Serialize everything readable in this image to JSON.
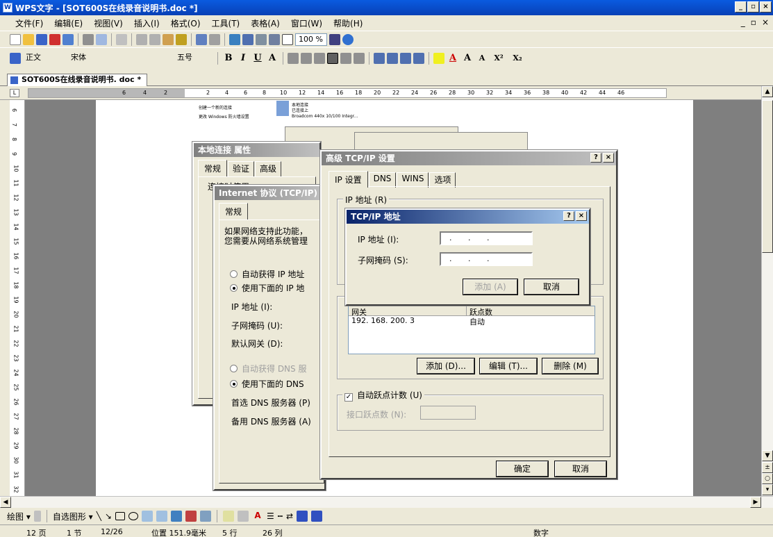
{
  "window": {
    "title": "WPS文字 - [SOT600S在线录音说明书.doc *]",
    "min": "_",
    "max": "▫",
    "close": "×",
    "mdi_min": "_",
    "mdi_restore": "▫",
    "mdi_close": "×"
  },
  "menu": [
    "文件(F)",
    "编辑(E)",
    "视图(V)",
    "插入(I)",
    "格式(O)",
    "工具(T)",
    "表格(A)",
    "窗口(W)",
    "帮助(H)"
  ],
  "toolbar": {
    "zoom": "100 %",
    "style": "正文",
    "font": "宋体",
    "size": "五号"
  },
  "format": {
    "bold": "B",
    "italic": "I",
    "underline": "U",
    "a": "A",
    "sup": "X²",
    "sub": "X₂"
  },
  "doc_tab": "SOT600S在线录音说明书. doc *",
  "ruler": {
    "left_nums": [
      "6",
      "4",
      "2"
    ],
    "nums": [
      "2",
      "4",
      "6",
      "8",
      "10",
      "12",
      "14",
      "16",
      "18",
      "20",
      "22",
      "24",
      "26",
      "28",
      "30",
      "32",
      "34",
      "36",
      "38",
      "40",
      "42",
      "44",
      "46"
    ]
  },
  "vruler": [
    "6",
    "7",
    "8",
    "9",
    "10",
    "11",
    "12",
    "13",
    "14",
    "15",
    "16",
    "17",
    "18",
    "19",
    "20",
    "21",
    "22",
    "23",
    "24",
    "25",
    "26",
    "27",
    "28",
    "29",
    "30",
    "31",
    "32"
  ],
  "thumb": {
    "item1": "创建一个新的连接",
    "item2": "更改 Windows 防火墙设置",
    "conn": "本地连接",
    "conn2": "已连接上",
    "conn3": "Broadcom 440x 10/100 Integr..."
  },
  "dlg_props": {
    "title": "本地连接 属性",
    "tabs": [
      "常规",
      "验证",
      "高级"
    ],
    "line": "连接时使用:"
  },
  "dlg_tcpip": {
    "title": "Internet 协议 (TCP/IP) 属",
    "tab": "常规",
    "desc1": "如果网络支持此功能，",
    "desc2": "您需要从网络系统管理",
    "r1": "自动获得 IP 地址",
    "r2": "使用下面的 IP 地",
    "l_ip": "IP 地址 (I):",
    "l_mask": "子网掩码 (U):",
    "l_gw": "默认网关 (D):",
    "r3": "自动获得 DNS 服",
    "r4": "使用下面的 DNS",
    "l_dns1": "首选 DNS 服务器 (P)",
    "l_dns2": "备用 DNS 服务器 (A)"
  },
  "dlg_adv": {
    "title": "高级 TCP/IP 设置",
    "tabs": [
      "IP 设置",
      "DNS",
      "WINS",
      "选项"
    ],
    "ip_group": "IP 地址 (R)",
    "gw_col1": "网关",
    "gw_col2": "跃点数",
    "gw_row_ip": "192. 168. 200. 3",
    "gw_row_metric": "自动",
    "add": "添加 (D)...",
    "edit": "编辑 (T)...",
    "del": "删除 (M)",
    "auto_metric": "自动跃点计数 (U)",
    "iface_metric": "接口跃点数 (N):",
    "ok": "确定",
    "cancel": "取消"
  },
  "dlg_addr": {
    "title": "TCP/IP 地址",
    "l_ip": "IP 地址 (I):",
    "l_mask": "子网掩码 (S):",
    "ip_val": ". . .",
    "mask_val": ". . .",
    "add": "添加 (A)",
    "cancel": "取消"
  },
  "drawbar": {
    "draw": "绘图 ▾",
    "autoshape": "自选图形 ▾"
  },
  "status": {
    "page": "12 页",
    "section": "1 节",
    "pages": "12/26",
    "pos": "位置 151.9毫米",
    "line": "5 行",
    "col": "26 列",
    "mode": "数字"
  }
}
